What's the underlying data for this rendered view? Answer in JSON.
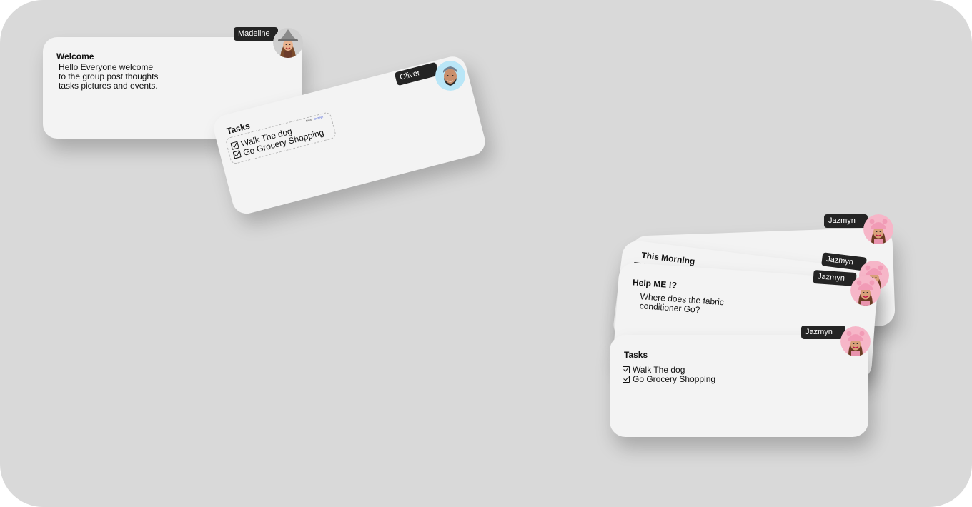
{
  "welcome_card": {
    "title": "Welcome",
    "body": "Hello Everyone welcome\nto the group post thoughts\ntasks pictures and events.",
    "author": "Madeline",
    "avatar_icon": "memoji-avatar-madeline"
  },
  "oliver_card": {
    "title": "Tasks",
    "tasks": [
      {
        "label": "Walk The dog",
        "checked": true
      },
      {
        "label": "Go Grocery Shopping",
        "checked": true
      }
    ],
    "mini_labels": [
      "New",
      "Jazmyn"
    ],
    "author": "Oliver",
    "avatar_icon": "memoji-avatar-oliver"
  },
  "stack": {
    "this_morning": {
      "title": "This Morning",
      "author": "Jazmyn",
      "partial_task": "Wa"
    },
    "middle_card": {
      "author": "Jazmyn"
    },
    "help_card": {
      "title": "Help ME !?",
      "body": "Where does the fabric\nconditioner Go?",
      "author": "Jazmyn"
    },
    "tasks_card": {
      "title": "Tasks",
      "tasks": [
        {
          "label": "Walk The dog",
          "checked": true
        },
        {
          "label": "Go Grocery Shopping",
          "checked": true
        }
      ],
      "author": "Jazmyn"
    },
    "avatar_icon": "memoji-avatar-jazmyn"
  },
  "colors": {
    "board": "#d9d9d9",
    "card": "#f3f3f3",
    "badge": "#242424",
    "madeline_avatar_bg": "#cfcfcf",
    "oliver_avatar_bg": "#b9e6f7",
    "jazmyn_avatar_bg": "#f6b6c8"
  }
}
